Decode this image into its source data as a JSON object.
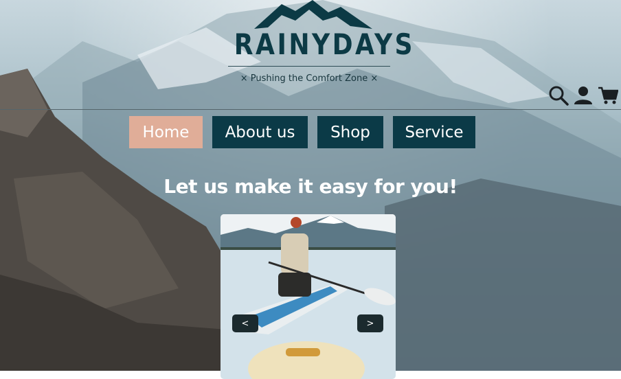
{
  "brand": {
    "name": "RAINYDAYS",
    "tagline": "× Pushing the Comfort Zone ×"
  },
  "header_icons": [
    "search-icon",
    "user-icon",
    "cart-icon"
  ],
  "nav": {
    "items": [
      {
        "label": "Home",
        "active": true
      },
      {
        "label": "About us",
        "active": false
      },
      {
        "label": "Shop",
        "active": false
      },
      {
        "label": "Service",
        "active": false
      }
    ]
  },
  "hero": {
    "headline": "Let us make it easy for you!"
  },
  "carousel": {
    "prev_label": "<",
    "next_label": ">"
  },
  "colors": {
    "nav_bg": "#0b3a47",
    "nav_active_bg": "#e0ad98",
    "logo": "#0c3a45"
  }
}
